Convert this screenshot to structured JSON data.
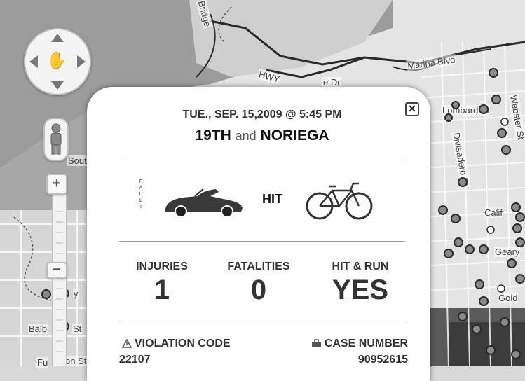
{
  "map": {
    "street_labels": {
      "marina_blvd": "Marina Blvd",
      "lombard": "Lombard St",
      "webster": "Webster St",
      "divisadero": "Divisadero St",
      "california": "Calif",
      "geary": "Geary",
      "golden": "Gold",
      "bridge": "Bridge",
      "south": "Sout",
      "balboa": "Balb",
      "balboa_st": "St",
      "fulton": "Fu",
      "fulton_st": "on St",
      "clay": "y",
      "hwy": "HWY",
      "dr": "e Dr"
    }
  },
  "controls": {
    "zoom_in_label": "+",
    "zoom_handle_label": "−",
    "pan_hand_glyph": "✋"
  },
  "popup": {
    "close_label": "✕",
    "date": "TUE., SEP. 15,2009 @ 5:45 PM",
    "location": {
      "street_a": "19TH",
      "connector": "and",
      "street_b": "NORIEGA"
    },
    "fault_label": "FAULT",
    "action_label": "HIT",
    "stats": [
      {
        "label": "INJURIES",
        "value": "1"
      },
      {
        "label": "FATALITIES",
        "value": "0"
      },
      {
        "label": "HIT & RUN",
        "value": "YES"
      }
    ],
    "violation_code": {
      "label": "VIOLATION CODE",
      "value": "22107",
      "icon": "warning-icon"
    },
    "case_number": {
      "label": "CASE NUMBER",
      "value": "90952615",
      "icon": "briefcase-icon"
    }
  },
  "colors": {
    "popup_bg": "#ffffff",
    "text": "#333333",
    "map_water": "#9a9a9a",
    "map_land": "#e3e3e3",
    "marker": "#8a8a8a"
  }
}
